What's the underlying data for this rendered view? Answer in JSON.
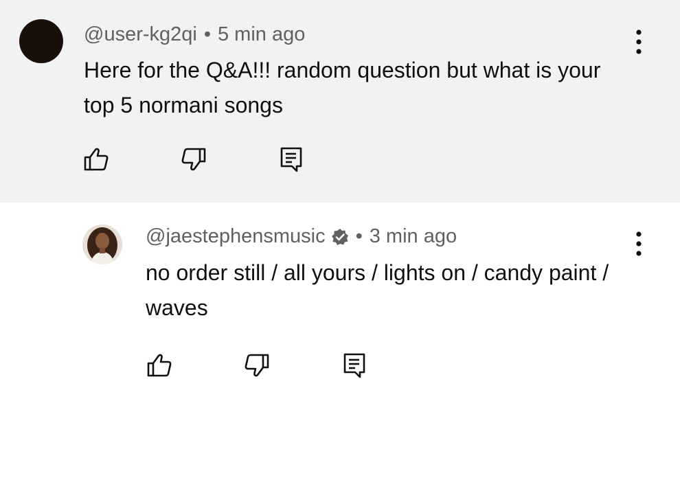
{
  "comments": [
    {
      "handle": "@user-kg2qi",
      "separator": "•",
      "time": "5 min ago",
      "text": "Here for the Q&A!!! random question but what is your top 5 normani songs",
      "avatar": "dark-circle-avatar",
      "verified": false
    },
    {
      "handle": "@jaestephensmusic",
      "separator": "•",
      "time": "3 min ago",
      "text": "no order still / all yours / lights on / candy paint / waves",
      "avatar": "profile-photo-avatar",
      "verified": true
    }
  ],
  "icons": {
    "like": "thumbs-up-icon",
    "dislike": "thumbs-down-icon",
    "reply": "reply-icon",
    "more": "more-vert-icon",
    "verified": "verified-badge-icon"
  },
  "colors": {
    "top_background": "#f2f2f2",
    "reply_background": "#ffffff",
    "meta_text": "#606060",
    "body_text": "#0f0f0f"
  }
}
